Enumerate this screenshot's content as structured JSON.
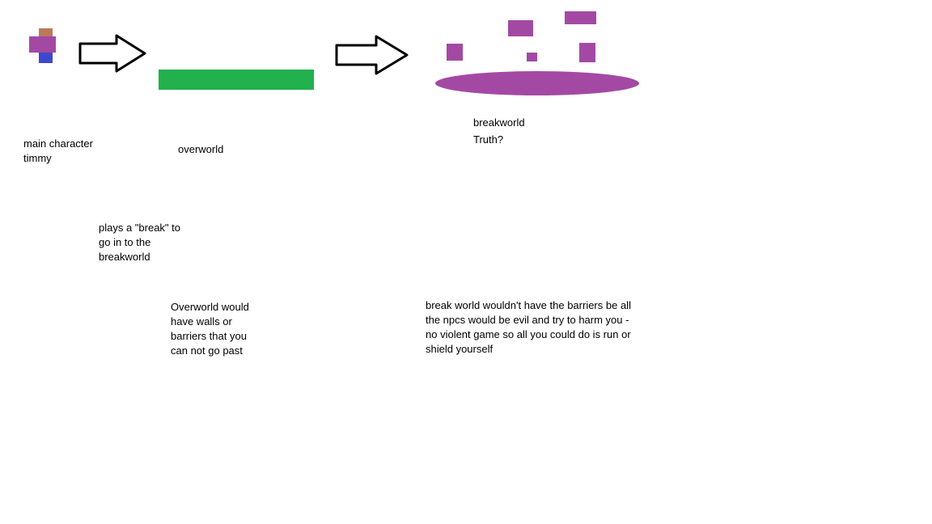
{
  "character": {
    "label_line1": "main character",
    "label_line2": "timmy",
    "colors": {
      "head": "#b97a57",
      "body": "#a349a4",
      "legs": "#3f48cc"
    }
  },
  "overworld": {
    "label": "overworld",
    "platform_color": "#22b14c",
    "note_lines": [
      "Overworld would",
      "have walls or",
      "barriers that you",
      "can not go past"
    ]
  },
  "transition": {
    "note_lines": [
      "plays a \"break\" to",
      "go in to the",
      "breakworld"
    ]
  },
  "breakworld": {
    "label": "breakworld",
    "sublabel": "Truth?",
    "color": "#a349a4",
    "note_lines": [
      "break world wouldn't have the barriers be all",
      "the npcs would be evil and try to harm you -",
      "no violent game so all you could do is run or",
      "shield yourself"
    ]
  },
  "icons": [
    "arrow-right-icon",
    "arrow-right-icon"
  ]
}
